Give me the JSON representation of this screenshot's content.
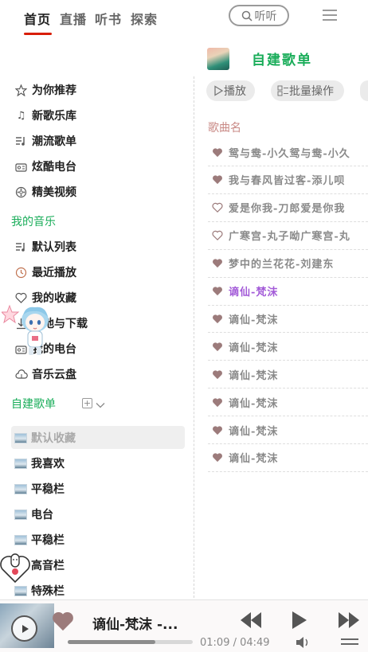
{
  "top_nav": {
    "tabs": [
      {
        "label": "首页",
        "active": true
      },
      {
        "label": "直播",
        "active": false
      },
      {
        "label": "听书",
        "active": false
      },
      {
        "label": "探索",
        "active": false
      }
    ],
    "search_placeholder": "听听"
  },
  "sidebar": {
    "main_items": [
      {
        "label": "为你推荐",
        "icon": "star-icon"
      },
      {
        "label": "新歌乐库",
        "icon": "music-note-icon"
      },
      {
        "label": "潮流歌单",
        "icon": "playlist-icon"
      },
      {
        "label": "炫酷电台",
        "icon": "radio-icon"
      },
      {
        "label": "精美视频",
        "icon": "video-icon"
      }
    ],
    "my_music_header": "我的音乐",
    "my_music_items": [
      {
        "label": "默认列表",
        "icon": "playlist-icon"
      },
      {
        "label": "最近播放",
        "icon": "clock-icon"
      },
      {
        "label": "我的收藏",
        "icon": "heart-icon"
      },
      {
        "label": "本地与下载",
        "icon": "download-icon"
      },
      {
        "label": "我的电台",
        "icon": "radio-icon"
      },
      {
        "label": "音乐云盘",
        "icon": "cloud-icon"
      }
    ],
    "custom_header": "自建歌单",
    "custom_playlists": [
      {
        "label": "默认收藏",
        "selected": true
      },
      {
        "label": "我喜欢",
        "selected": false
      },
      {
        "label": "平稳栏",
        "selected": false
      },
      {
        "label": "电台",
        "selected": false
      },
      {
        "label": "平稳栏",
        "selected": false
      },
      {
        "label": "高音栏",
        "selected": false
      },
      {
        "label": "特殊栏",
        "selected": false
      }
    ]
  },
  "playlist": {
    "title": "自建歌单",
    "play_button": "播放",
    "batch_button": "批量操作",
    "column_header": "歌曲名",
    "songs": [
      {
        "title": "鸳与鸯-小久鸳与鸯-小久",
        "liked": true,
        "playing": false
      },
      {
        "title": "我与春风皆过客-添儿呗",
        "liked": true,
        "playing": false
      },
      {
        "title": "爱是你我-刀郎爱是你我",
        "liked": false,
        "playing": false
      },
      {
        "title": "广寒宫-丸子呦广寒宫-丸",
        "liked": false,
        "playing": false
      },
      {
        "title": "梦中的兰花花-刘建东",
        "liked": true,
        "playing": false
      },
      {
        "title": "谪仙-梵沫",
        "liked": true,
        "playing": true
      },
      {
        "title": "谪仙-梵沫",
        "liked": true,
        "playing": false
      },
      {
        "title": "谪仙-梵沫",
        "liked": true,
        "playing": false
      },
      {
        "title": "谪仙-梵沫",
        "liked": true,
        "playing": false
      },
      {
        "title": "谪仙-梵沫",
        "liked": true,
        "playing": false
      },
      {
        "title": "谪仙-梵沫",
        "liked": true,
        "playing": false
      },
      {
        "title": "谪仙-梵沫",
        "liked": true,
        "playing": false
      }
    ]
  },
  "player": {
    "now_playing": "谪仙-梵沫 -...",
    "time": "01:09 / 04:49",
    "progress": 0.7
  },
  "colors": {
    "accent_green": "#1aad5a",
    "active_red": "#d81e06",
    "playing_purple": "#a35bd8",
    "header_pink": "#c98a86"
  }
}
